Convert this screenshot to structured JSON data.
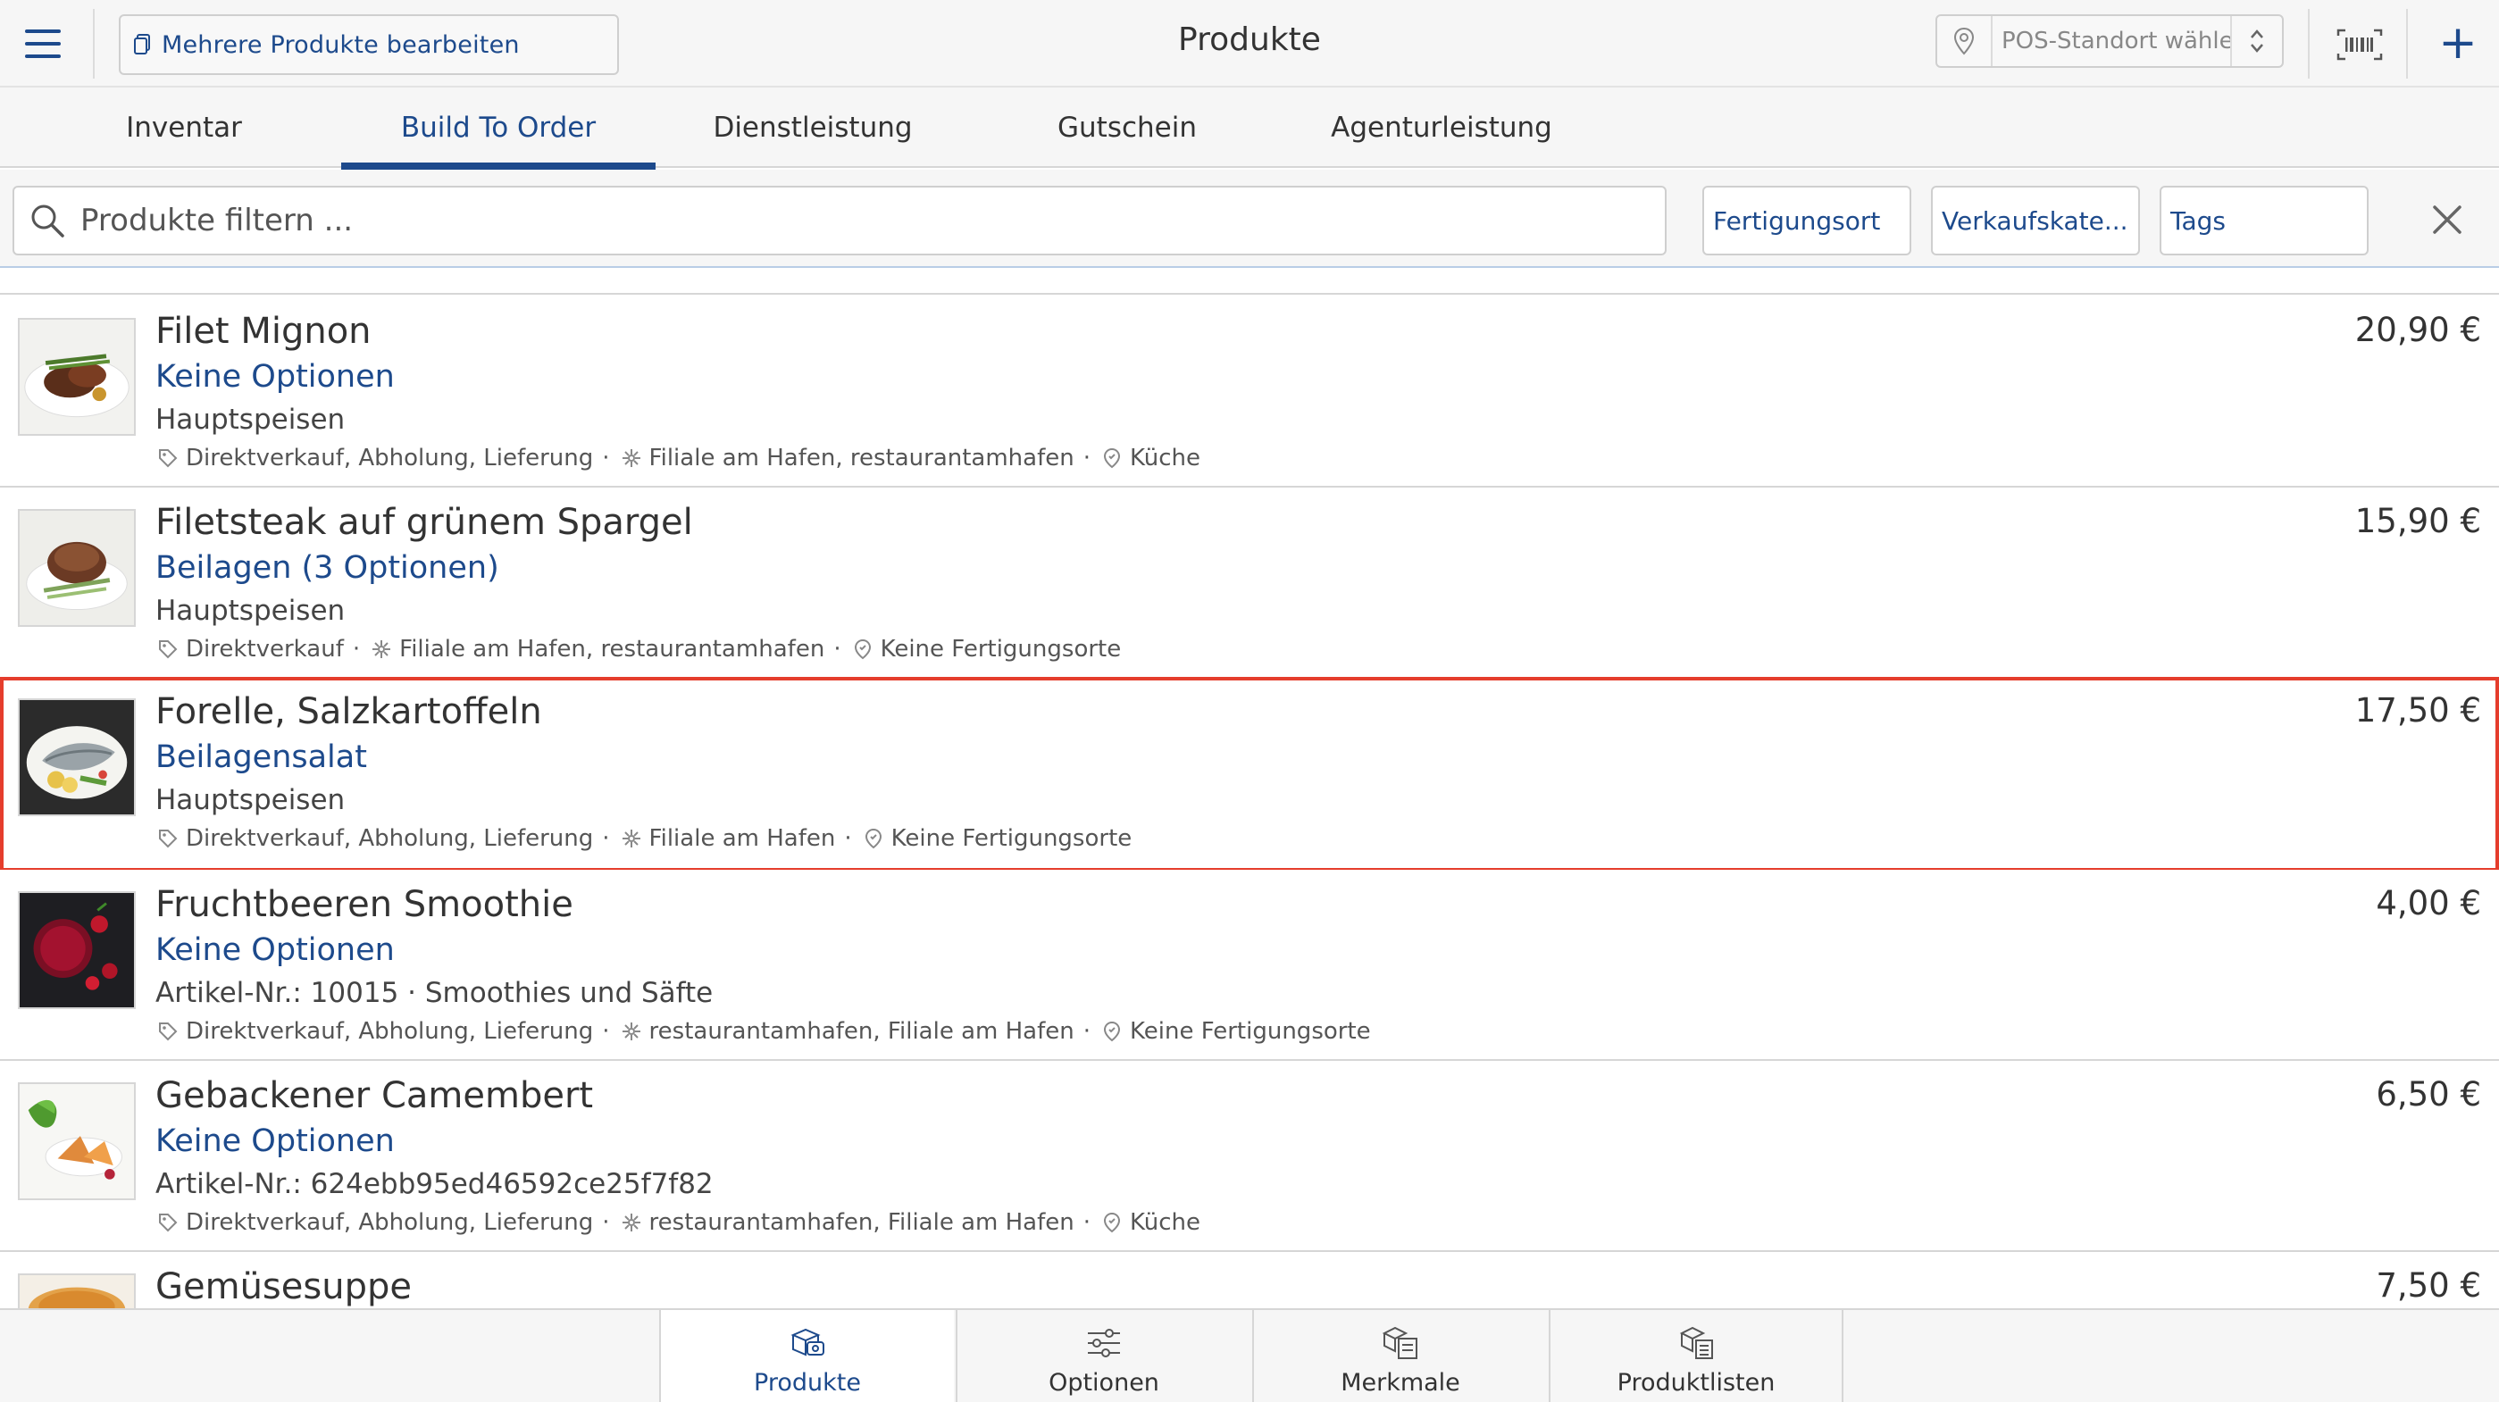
{
  "header": {
    "bulk_edit_label": "Mehrere Produkte bearbeiten",
    "title": "Produkte",
    "pos_placeholder": "POS-Standort wählen..."
  },
  "tabs": [
    {
      "label": "Inventar",
      "active": false
    },
    {
      "label": "Build To Order",
      "active": true
    },
    {
      "label": "Dienstleistung",
      "active": false
    },
    {
      "label": "Gutschein",
      "active": false
    },
    {
      "label": "Agenturleistung",
      "active": false
    }
  ],
  "filter": {
    "search_placeholder": "Produkte filtern ...",
    "chips": [
      "Fertigungsort",
      "Verkaufskate...",
      "Tags"
    ]
  },
  "products": [
    {
      "name": "Filet Mignon",
      "options": "Keine Optionen",
      "category": "Hauptspeisen",
      "sales": "Direktverkauf, Abholung, Lieferung",
      "locations": "Filiale am Hafen, restaurantamhafen",
      "production": "Küche",
      "price": "20,90 €",
      "selected": false
    },
    {
      "name": "Filetsteak auf grünem Spargel",
      "options": "Beilagen (3 Optionen)",
      "category": "Hauptspeisen",
      "sales": "Direktverkauf",
      "locations": "Filiale am Hafen, restaurantamhafen",
      "production": "Keine Fertigungsorte",
      "price": "15,90 €",
      "selected": false
    },
    {
      "name": "Forelle, Salzkartoffeln",
      "options": "Beilagensalat",
      "category": "Hauptspeisen",
      "sales": "Direktverkauf, Abholung, Lieferung",
      "locations": "Filiale am Hafen",
      "production": "Keine Fertigungsorte",
      "price": "17,50 €",
      "selected": true
    },
    {
      "name": "Fruchtbeeren Smoothie",
      "options": "Keine Optionen",
      "category": "Artikel-Nr.: 10015 · Smoothies und Säfte",
      "sales": "Direktverkauf, Abholung, Lieferung",
      "locations": "restaurantamhafen, Filiale am Hafen",
      "production": "Keine Fertigungsorte",
      "price": "4,00 €",
      "selected": false
    },
    {
      "name": "Gebackener Camembert",
      "options": "Keine Optionen",
      "category": "Artikel-Nr.: 624ebb95ed46592ce25f7f82",
      "sales": "Direktverkauf, Abholung, Lieferung",
      "locations": "restaurantamhafen, Filiale am Hafen",
      "production": "Küche",
      "price": "6,50 €",
      "selected": false
    },
    {
      "name": "Gemüsesuppe",
      "options": "",
      "category": "",
      "sales": "",
      "locations": "",
      "production": "",
      "price": "7,50 €",
      "selected": false
    }
  ],
  "bottom_tabs": [
    {
      "label": "Produkte",
      "icon": "product-box-icon",
      "active": true
    },
    {
      "label": "Optionen",
      "icon": "sliders-icon",
      "active": false
    },
    {
      "label": "Merkmale",
      "icon": "attributes-icon",
      "active": false
    },
    {
      "label": "Produktlisten",
      "icon": "product-list-icon",
      "active": false
    }
  ],
  "colors": {
    "accent": "#1d4a8c",
    "selection_border": "#e53d2c",
    "bar_background": "#f6f6f6"
  }
}
